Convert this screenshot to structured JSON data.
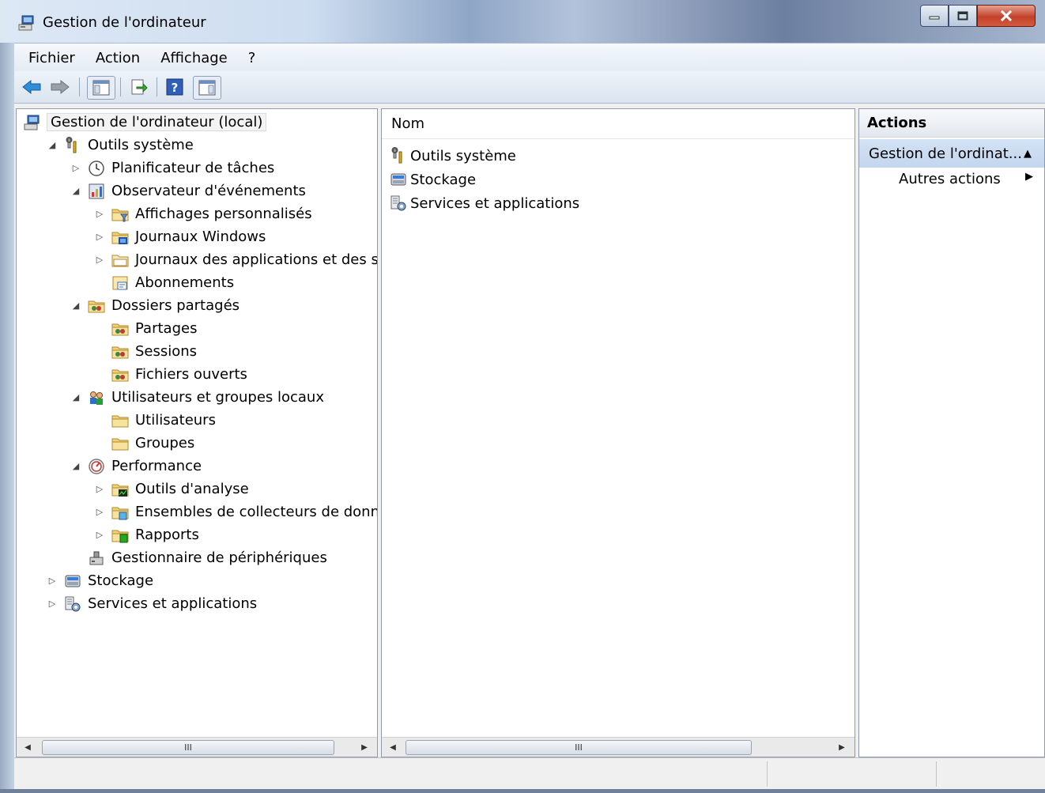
{
  "window": {
    "title": "Gestion de l'ordinateur"
  },
  "menu": [
    "Fichier",
    "Action",
    "Affichage",
    "?"
  ],
  "tree": [
    {
      "label": "Gestion de l'ordinateur (local)",
      "icon": "computer-management-icon",
      "level": 0,
      "expander": "none",
      "selected": true
    },
    {
      "label": "Outils système",
      "icon": "system-tools-icon",
      "level": 1,
      "expander": "expanded"
    },
    {
      "label": "Planificateur de tâches",
      "icon": "clock-icon",
      "level": 2,
      "expander": "collapsed"
    },
    {
      "label": "Observateur d'événements",
      "icon": "event-viewer-icon",
      "level": 2,
      "expander": "expanded"
    },
    {
      "label": "Affichages personnalisés",
      "icon": "folder-filter-icon",
      "level": 3,
      "expander": "collapsed"
    },
    {
      "label": "Journaux Windows",
      "icon": "folder-windows-icon",
      "level": 3,
      "expander": "collapsed"
    },
    {
      "label": "Journaux des applications et des servic",
      "icon": "folder-log-icon",
      "level": 3,
      "expander": "collapsed"
    },
    {
      "label": "Abonnements",
      "icon": "subscriptions-icon",
      "level": 3,
      "expander": "none"
    },
    {
      "label": "Dossiers partagés",
      "icon": "shared-folder-icon",
      "level": 2,
      "expander": "expanded"
    },
    {
      "label": "Partages",
      "icon": "shared-folder-icon",
      "level": 3,
      "expander": "none"
    },
    {
      "label": "Sessions",
      "icon": "shared-folder-icon",
      "level": 3,
      "expander": "none"
    },
    {
      "label": "Fichiers ouverts",
      "icon": "shared-folder-icon",
      "level": 3,
      "expander": "none"
    },
    {
      "label": "Utilisateurs et groupes locaux",
      "icon": "users-icon",
      "level": 2,
      "expander": "expanded"
    },
    {
      "label": "Utilisateurs",
      "icon": "folder-icon",
      "level": 3,
      "expander": "none"
    },
    {
      "label": "Groupes",
      "icon": "folder-icon",
      "level": 3,
      "expander": "none"
    },
    {
      "label": "Performance",
      "icon": "performance-icon",
      "level": 2,
      "expander": "expanded"
    },
    {
      "label": "Outils d'analyse",
      "icon": "folder-chart-icon",
      "level": 3,
      "expander": "collapsed"
    },
    {
      "label": "Ensembles de collecteurs de données",
      "icon": "folder-collector-icon",
      "level": 3,
      "expander": "collapsed"
    },
    {
      "label": "Rapports",
      "icon": "folder-report-icon",
      "level": 3,
      "expander": "collapsed"
    },
    {
      "label": "Gestionnaire de périphériques",
      "icon": "device-manager-icon",
      "level": 2,
      "expander": "none"
    },
    {
      "label": "Stockage",
      "icon": "storage-icon",
      "level": 1,
      "expander": "collapsed"
    },
    {
      "label": "Services et applications",
      "icon": "services-icon",
      "level": 1,
      "expander": "collapsed"
    }
  ],
  "list": {
    "column": "Nom",
    "items": [
      {
        "label": "Outils système",
        "icon": "system-tools-icon"
      },
      {
        "label": "Stockage",
        "icon": "storage-icon"
      },
      {
        "label": "Services et applications",
        "icon": "services-icon"
      }
    ]
  },
  "actions": {
    "header": "Actions",
    "group": "Gestion de l'ordinat...",
    "items": [
      "Autres actions"
    ]
  },
  "scroll_glyph": "III",
  "colors": {
    "selection_bg": "#c3d6ee",
    "title_close": "#c2412b"
  }
}
